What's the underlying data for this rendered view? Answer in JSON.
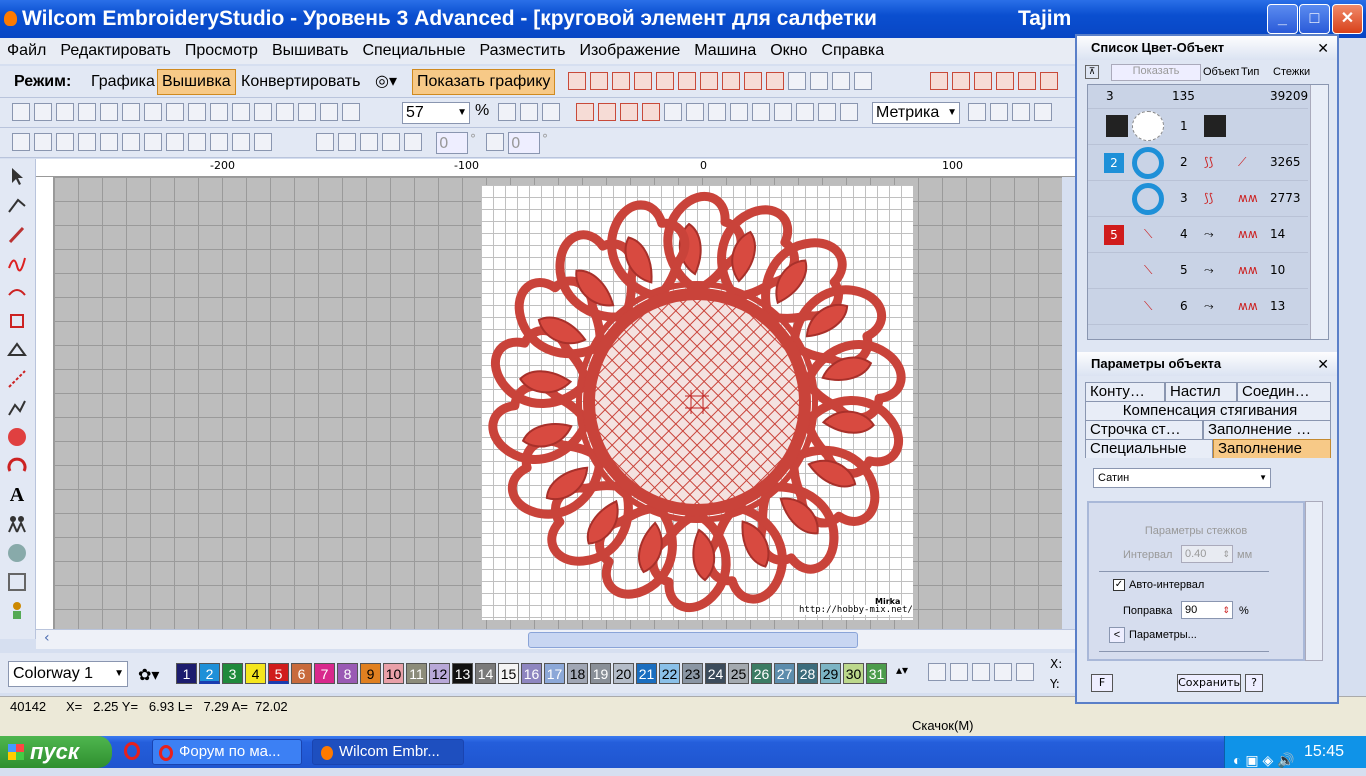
{
  "window": {
    "title": "Wilcom EmbroideryStudio - Уровень 3 Advanced - [круговой элемент для салфетки",
    "title_suffix": "Tajim"
  },
  "menu": [
    "Файл",
    "Редактировать",
    "Просмотр",
    "Вышивать",
    "Специальные",
    "Разместить",
    "Изображение",
    "Машина",
    "Окно",
    "Справка"
  ],
  "mode": {
    "label": "Режим:",
    "graphics": "Графика",
    "embroidery": "Вышивка",
    "convert": "Конвертировать",
    "show_graphics": "Показать графику"
  },
  "toolbar": {
    "zoom": "57",
    "percent": "%",
    "units": "Метрика",
    "angle1": "0",
    "angle2": "0",
    "deg": "°"
  },
  "ruler": {
    "m200": "-200",
    "m100": "-100",
    "zero": "0",
    "p100": "100"
  },
  "design": {
    "watermark_brand": "Mirka",
    "watermark_url": "http://hobby-mix.net/"
  },
  "colorway": {
    "name": "Colorway 1",
    "swatches": [
      {
        "n": "1",
        "c": "#1c1c6e",
        "t": "#fff"
      },
      {
        "n": "2",
        "c": "#1e90d8",
        "t": "#fff"
      },
      {
        "n": "3",
        "c": "#1f8a3c",
        "t": "#fff"
      },
      {
        "n": "4",
        "c": "#f5e61e",
        "t": "#000"
      },
      {
        "n": "5",
        "c": "#d01c1c",
        "t": "#fff"
      },
      {
        "n": "6",
        "c": "#c86a3c",
        "t": "#fff"
      },
      {
        "n": "7",
        "c": "#d8288c",
        "t": "#fff"
      },
      {
        "n": "8",
        "c": "#9a5ab4",
        "t": "#fff"
      },
      {
        "n": "9",
        "c": "#e08020",
        "t": "#000"
      },
      {
        "n": "10",
        "c": "#e8a0a8",
        "t": "#000"
      },
      {
        "n": "11",
        "c": "#8c8c7a",
        "t": "#fff"
      },
      {
        "n": "12",
        "c": "#b8a8d8",
        "t": "#000"
      },
      {
        "n": "13",
        "c": "#111111",
        "t": "#fff"
      },
      {
        "n": "14",
        "c": "#7a7a7a",
        "t": "#fff"
      },
      {
        "n": "15",
        "c": "#f4f4f4",
        "t": "#000"
      },
      {
        "n": "16",
        "c": "#8e86c0",
        "t": "#fff"
      },
      {
        "n": "17",
        "c": "#8ca8d8",
        "t": "#fff"
      },
      {
        "n": "18",
        "c": "#a0a6b4",
        "t": "#000"
      },
      {
        "n": "19",
        "c": "#8a9098",
        "t": "#fff"
      },
      {
        "n": "20",
        "c": "#b4bcc8",
        "t": "#000"
      },
      {
        "n": "21",
        "c": "#1a6ec0",
        "t": "#fff"
      },
      {
        "n": "22",
        "c": "#8ac0e8",
        "t": "#000"
      },
      {
        "n": "23",
        "c": "#8a96a4",
        "t": "#000"
      },
      {
        "n": "24",
        "c": "#3c4c5c",
        "t": "#fff"
      },
      {
        "n": "25",
        "c": "#a4aab0",
        "t": "#000"
      },
      {
        "n": "26",
        "c": "#3c7c64",
        "t": "#fff"
      },
      {
        "n": "27",
        "c": "#5c8cac",
        "t": "#fff"
      },
      {
        "n": "28",
        "c": "#3c6c7c",
        "t": "#fff"
      },
      {
        "n": "29",
        "c": "#7cb4c4",
        "t": "#000"
      },
      {
        "n": "30",
        "c": "#bcd88c",
        "t": "#000"
      },
      {
        "n": "31",
        "c": "#4c9c4c",
        "t": "#fff"
      }
    ]
  },
  "coords": {
    "x": "X:",
    "y": "Y:"
  },
  "status": {
    "stitches": "40142",
    "readout": "X=   2.25 Y=   6.93 L=   7.29 A=  72.02",
    "jump": "Скачок(M)"
  },
  "colorlist": {
    "title": "Список Цвет-Объект",
    "show_btn": "Показать",
    "col_obj": "Объект",
    "col_type": "Тип",
    "col_stitches": "Стежки",
    "summary": {
      "colors": "3",
      "objects": "135",
      "stitches": "39209"
    },
    "rows": [
      {
        "color": "",
        "num": "1",
        "stitches": ""
      },
      {
        "color": "2",
        "num": "2",
        "stitches": "3265"
      },
      {
        "color": "",
        "num": "3",
        "stitches": "2773"
      },
      {
        "color": "5",
        "num": "4",
        "stitches": "14"
      },
      {
        "color": "",
        "num": "5",
        "stitches": "10"
      },
      {
        "color": "",
        "num": "6",
        "stitches": "13"
      }
    ]
  },
  "objparams": {
    "title": "Параметры объекта",
    "tabs1": [
      "Конту…",
      "Настил",
      "Соедин…"
    ],
    "tab_comp": "Компенсация стягивания",
    "tabs2": [
      "Строчка ст…",
      "Заполнение …"
    ],
    "tabs3": [
      "Специальные",
      "Заполнение"
    ],
    "fill_type": "Сатин",
    "stitch_params": "Параметры стежков",
    "interval_label": "Интервал",
    "interval_value": "0.40",
    "interval_unit": "мм",
    "auto_interval": "Авто-интервал",
    "correction_label": "Поправка",
    "correction_value": "90",
    "correction_unit": "%",
    "params_btn": "Параметры...",
    "f_btn": "F",
    "save_btn": "Сохранить",
    "help_btn": "?"
  },
  "taskbar": {
    "start": "пуск",
    "opera_label": "Форум по ма...",
    "wilcom_label": "Wilcom Embr...",
    "clock": "15:45"
  }
}
